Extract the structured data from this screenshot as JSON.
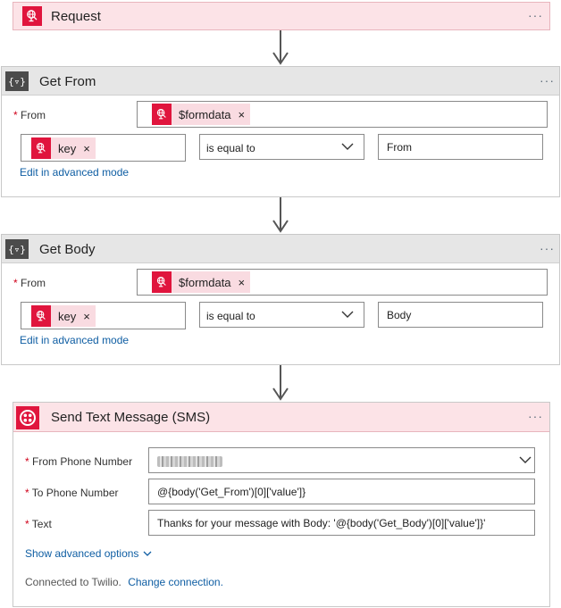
{
  "request": {
    "title": "Request",
    "menu": "···"
  },
  "get_from": {
    "title": "Get From",
    "menu": "···",
    "from_label": "From",
    "from_token": "$formdata",
    "token_remove": "×",
    "key_token": "key",
    "operator": "is equal to",
    "value": "From",
    "advanced_link": "Edit in advanced mode"
  },
  "get_body": {
    "title": "Get Body",
    "menu": "···",
    "from_label": "From",
    "from_token": "$formdata",
    "token_remove": "×",
    "key_token": "key",
    "operator": "is equal to",
    "value": "Body",
    "advanced_link": "Edit in advanced mode"
  },
  "send_sms": {
    "title": "Send Text Message (SMS)",
    "menu": "···",
    "from_phone_label": "From Phone Number",
    "from_phone_value": "",
    "to_phone_label": "To Phone Number",
    "to_phone_value": "@{body('Get_From')[0]['value']}",
    "text_label": "Text",
    "text_value": "Thanks for your message with Body: '@{body('Get_Body')[0]['value']}'",
    "show_advanced": "Show advanced options",
    "connected_text": "Connected to Twilio.",
    "change_connection": "Change connection."
  },
  "required_marker": "*",
  "colors": {
    "request_red": "#e0153d",
    "header_pink": "#fce3e7",
    "header_grey": "#e6e6e6",
    "link_blue": "#0f5ea3"
  },
  "icons": {
    "request": "globe-icon",
    "compose": "variable-braces-icon",
    "twilio": "twilio-icon"
  }
}
